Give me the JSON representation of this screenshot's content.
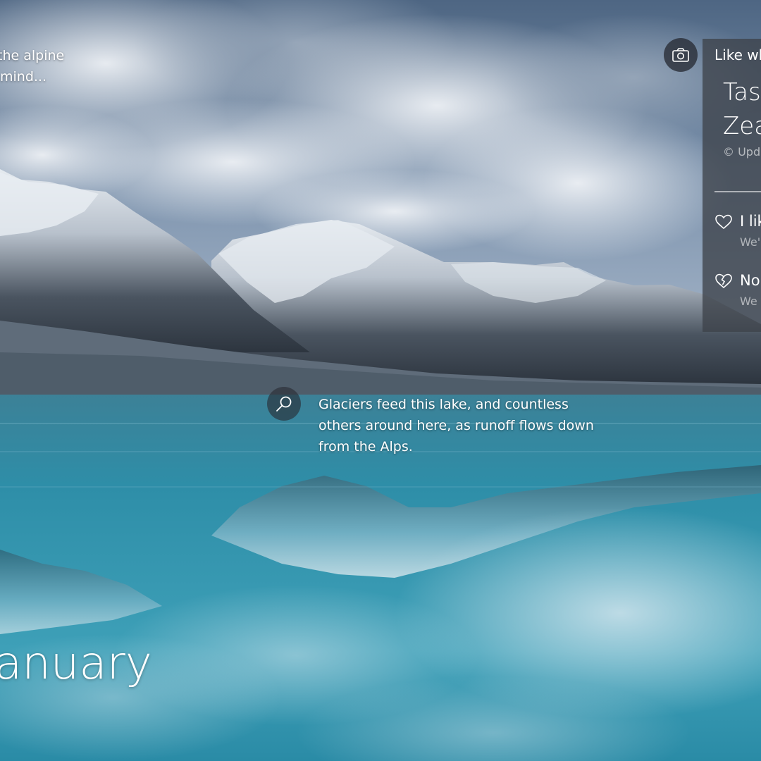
{
  "top_caption": {
    "line1": "the alpine",
    "line2": "mind..."
  },
  "camera_button": {
    "icon": "camera-icon"
  },
  "info_panel": {
    "heading": "Like wh",
    "title_line1": "Tasr",
    "title_line2": "Zea",
    "credit": "© Upd",
    "like_option": {
      "icon": "heart-icon",
      "label": "I lik",
      "sublabel": "We'"
    },
    "dislike_option": {
      "icon": "broken-heart-icon",
      "label": "No",
      "sublabel": "We"
    }
  },
  "hotspot": {
    "icon": "search-icon",
    "line1": "Glaciers feed this lake, and countless",
    "line2": "others around here, as runoff flows down",
    "line3": "from the Alps."
  },
  "date": {
    "month": "anuary"
  },
  "colors": {
    "panel_bg": "#3e424a",
    "text": "#ffffff",
    "muted_text": "#9aa0a8"
  }
}
